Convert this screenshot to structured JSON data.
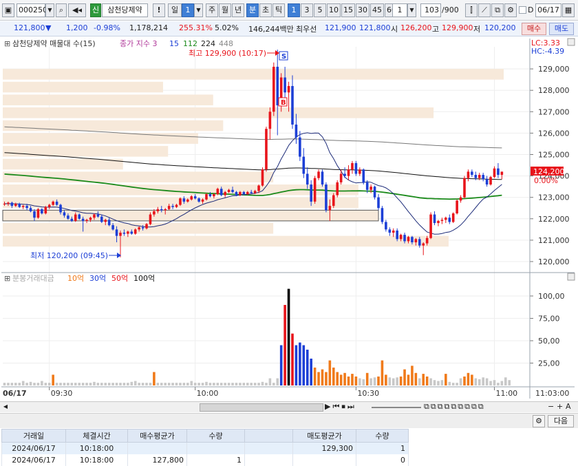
{
  "toolbar": {
    "code": "000250",
    "stock_badge": "신",
    "stock_name": "삼천당제약",
    "alert": "!",
    "period_day": "일",
    "period_count": "1",
    "period_week": "주",
    "period_month": "월",
    "period_year": "년",
    "period_minute": "분",
    "period_second": "초",
    "period_tick": "틱",
    "intervals": [
      "1",
      "3",
      "5",
      "10",
      "15",
      "30",
      "45",
      "60"
    ],
    "interval_input": "1",
    "page": "103",
    "page_total": "/900",
    "date_check_label": "D",
    "date": "06/17"
  },
  "quote": {
    "price": "121,800",
    "change_arrow": "▼",
    "change": "1,200",
    "change_rate": "-0.98%",
    "volume": "1,178,214",
    "volume_ratio": "255.31%",
    "turnover": "5.02%",
    "amount": "146,244백만",
    "best_label": "최우선",
    "best_ask": "121,900",
    "best_bid": "121,800",
    "open_label": "시",
    "open": "126,200",
    "high_label": "고",
    "high": "129,900",
    "low_label": "저",
    "low": "120,200",
    "buy_btn": "매수",
    "sell_btn": "매도"
  },
  "colors": {
    "up": "#e8141b",
    "down": "#1c3fd6",
    "ma_green": "#1a8a1a",
    "navy": "#1b2a78",
    "gray": "#777777",
    "profile": "#f7e9da"
  },
  "chart_data": {
    "type": "candlestick",
    "price_panel": {
      "legend": {
        "title": "삼천당제약 매물대 수(15)",
        "ma_label": "종가 지수 3",
        "ma_periods": [
          "15",
          "112",
          "224",
          "448"
        ]
      },
      "lc": "LC:3.33",
      "hc": "HC:-4.39",
      "current_price": "124,200",
      "current_rate": "0.00%",
      "y_ticks": [
        "129,000",
        "128,000",
        "127,000",
        "126,000",
        "125,000",
        "124,000",
        "123,000",
        "122,000",
        "121,000",
        "120,000"
      ],
      "ylim": [
        119700,
        130200
      ],
      "high_annotation": "최고 129,900 (10:17)",
      "low_annotation": "최저 120,200 (09:45)",
      "signal_sell": "S",
      "signal_buy": "B",
      "volume_profile": [
        {
          "price_lo": 128500,
          "price_hi": 129000,
          "relative": 1.0
        },
        {
          "price_lo": 127900,
          "price_hi": 128400,
          "relative": 0.32
        },
        {
          "price_lo": 127300,
          "price_hi": 127800,
          "relative": 0.42
        },
        {
          "price_lo": 126700,
          "price_hi": 127200,
          "relative": 0.86
        },
        {
          "price_lo": 126100,
          "price_hi": 126600,
          "relative": 0.44
        },
        {
          "price_lo": 125500,
          "price_hi": 126000,
          "relative": 0.39
        },
        {
          "price_lo": 124900,
          "price_hi": 125400,
          "relative": 0.33
        },
        {
          "price_lo": 124300,
          "price_hi": 124800,
          "relative": 0.24
        },
        {
          "price_lo": 123700,
          "price_hi": 124200,
          "relative": 0.54
        },
        {
          "price_lo": 123100,
          "price_hi": 123600,
          "relative": 0.71
        },
        {
          "price_lo": 122500,
          "price_hi": 123000,
          "relative": 0.71
        },
        {
          "price_lo": 121900,
          "price_hi": 122400,
          "relative": 0.75
        },
        {
          "price_lo": 121300,
          "price_hi": 121800,
          "relative": 0.54
        },
        {
          "price_lo": 120700,
          "price_hi": 121200,
          "relative": 0.89
        }
      ]
    },
    "volume_panel": {
      "legend": {
        "title": "분봉거래대금",
        "items": [
          "10억",
          "30억",
          "50억",
          "100억"
        ]
      },
      "y_ticks": [
        "100,00",
        "75,00",
        "50,00",
        "25,00"
      ],
      "ylim": [
        0,
        110
      ]
    },
    "x_ticks": [
      "06/17",
      "09:30",
      "10:00",
      "10:30",
      "11:00",
      "11:03:00"
    ],
    "candles": [
      [
        122700,
        122800,
        122600,
        122700
      ],
      [
        122700,
        122800,
        122600,
        122750
      ],
      [
        122750,
        122800,
        122500,
        122600
      ],
      [
        122600,
        122750,
        122550,
        122700
      ],
      [
        122700,
        122750,
        122500,
        122550
      ],
      [
        122550,
        122650,
        122450,
        122600
      ],
      [
        122600,
        122700,
        122400,
        122500
      ],
      [
        122500,
        122600,
        122300,
        122350
      ],
      [
        122350,
        122450,
        121900,
        122050
      ],
      [
        122050,
        122500,
        122000,
        122450
      ],
      [
        122450,
        122500,
        122200,
        122250
      ],
      [
        122250,
        122600,
        122200,
        122550
      ],
      [
        122550,
        122700,
        122450,
        122650
      ],
      [
        122650,
        122850,
        122600,
        122800
      ],
      [
        122800,
        122900,
        122600,
        122650
      ],
      [
        122650,
        122700,
        122200,
        122300
      ],
      [
        122300,
        122400,
        122050,
        122150
      ],
      [
        122150,
        122250,
        121950,
        122000
      ],
      [
        122000,
        122100,
        121850,
        121900
      ],
      [
        121900,
        122300,
        121850,
        122200
      ],
      [
        122200,
        122250,
        121950,
        122000
      ],
      [
        122000,
        122100,
        121400,
        121900
      ],
      [
        121900,
        122000,
        121800,
        121950
      ],
      [
        121950,
        122100,
        121850,
        122050
      ],
      [
        122050,
        122250,
        121950,
        122200
      ],
      [
        122200,
        122350,
        122050,
        122100
      ],
      [
        122100,
        122200,
        121800,
        121850
      ],
      [
        121850,
        122000,
        121700,
        121950
      ],
      [
        121950,
        122050,
        121650,
        121700
      ],
      [
        121700,
        121800,
        121450,
        121500
      ],
      [
        121500,
        121650,
        120900,
        121200
      ],
      [
        121200,
        121450,
        120200,
        121350
      ],
      [
        121350,
        121500,
        121200,
        121300
      ],
      [
        121300,
        121450,
        121150,
        121400
      ],
      [
        121400,
        121500,
        121250,
        121300
      ],
      [
        121300,
        121550,
        121250,
        121500
      ],
      [
        121500,
        121650,
        121400,
        121600
      ],
      [
        121600,
        121700,
        121450,
        121550
      ],
      [
        121550,
        121800,
        121500,
        121750
      ],
      [
        121750,
        122300,
        121700,
        122200
      ],
      [
        122200,
        122450,
        122100,
        122350
      ],
      [
        122350,
        122550,
        122250,
        122450
      ],
      [
        122450,
        122600,
        122300,
        122400
      ],
      [
        122400,
        122500,
        122200,
        122450
      ],
      [
        122450,
        122700,
        122400,
        122600
      ],
      [
        122600,
        122700,
        122450,
        122550
      ],
      [
        122550,
        122700,
        122500,
        122650
      ],
      [
        122650,
        123000,
        122600,
        122950
      ],
      [
        122950,
        123050,
        122700,
        122800
      ],
      [
        122800,
        122950,
        122750,
        122900
      ],
      [
        122900,
        123100,
        122850,
        123050
      ],
      [
        123050,
        123150,
        122900,
        122950
      ],
      [
        122950,
        123000,
        122750,
        122800
      ],
      [
        122800,
        122950,
        122700,
        122900
      ],
      [
        122900,
        123200,
        122850,
        123150
      ],
      [
        123150,
        123250,
        123000,
        123050
      ],
      [
        123050,
        123200,
        122950,
        123150
      ],
      [
        123150,
        123450,
        123100,
        123400
      ],
      [
        123400,
        123500,
        123050,
        123100
      ],
      [
        123100,
        123300,
        123000,
        123250
      ],
      [
        123250,
        123400,
        123200,
        123350
      ],
      [
        123350,
        123500,
        123200,
        123250
      ],
      [
        123250,
        123300,
        123050,
        123100
      ],
      [
        123100,
        123300,
        123050,
        123250
      ],
      [
        123250,
        123300,
        123100,
        123150
      ],
      [
        123150,
        123300,
        123100,
        123250
      ],
      [
        123250,
        123350,
        123150,
        123200
      ],
      [
        123200,
        123350,
        123150,
        123300
      ],
      [
        123300,
        123600,
        123200,
        123550
      ],
      [
        123550,
        124400,
        123500,
        124300
      ],
      [
        124300,
        126300,
        124200,
        126200
      ],
      [
        126200,
        127200,
        125700,
        127000
      ],
      [
        127000,
        129300,
        126800,
        129100
      ],
      [
        129100,
        129900,
        125900,
        127300
      ],
      [
        127300,
        128800,
        127000,
        128600
      ],
      [
        128600,
        129100,
        127600,
        127900
      ],
      [
        127900,
        128400,
        127000,
        128200
      ],
      [
        128200,
        128700,
        126200,
        126400
      ],
      [
        126400,
        126900,
        125500,
        125800
      ],
      [
        125800,
        126100,
        124700,
        124900
      ],
      [
        124900,
        125300,
        123900,
        124100
      ],
      [
        124100,
        124400,
        123400,
        123600
      ],
      [
        123600,
        123800,
        122600,
        122800
      ],
      [
        122800,
        124000,
        122700,
        123900
      ],
      [
        123900,
        124300,
        123800,
        124200
      ],
      [
        124200,
        124300,
        123500,
        123600
      ],
      [
        123600,
        123700,
        122300,
        122400
      ],
      [
        122400,
        122900,
        121900,
        122600
      ],
      [
        122600,
        123200,
        122500,
        123100
      ],
      [
        123100,
        123800,
        123000,
        123700
      ],
      [
        123700,
        124300,
        123600,
        124100
      ],
      [
        124100,
        124400,
        123900,
        124000
      ],
      [
        124000,
        124500,
        123800,
        124300
      ],
      [
        124300,
        124700,
        124100,
        124600
      ],
      [
        124600,
        124700,
        124000,
        124100
      ],
      [
        124100,
        124400,
        124000,
        124300
      ],
      [
        124300,
        124350,
        123600,
        123700
      ],
      [
        123700,
        123800,
        123200,
        123350
      ],
      [
        123350,
        123600,
        123200,
        123500
      ],
      [
        123500,
        123550,
        122900,
        123000
      ],
      [
        123000,
        123150,
        122400,
        122500
      ],
      [
        122500,
        122600,
        121750,
        121850
      ],
      [
        121850,
        121950,
        121400,
        121500
      ],
      [
        121500,
        121600,
        121200,
        121350
      ],
      [
        121350,
        121550,
        121150,
        121450
      ],
      [
        121450,
        121550,
        120950,
        121050
      ],
      [
        121050,
        121300,
        120950,
        121250
      ],
      [
        121250,
        121350,
        120850,
        120950
      ],
      [
        120950,
        121200,
        120850,
        121150
      ],
      [
        121150,
        121200,
        120800,
        120900
      ],
      [
        120900,
        121100,
        120750,
        121050
      ],
      [
        121050,
        121150,
        120650,
        120750
      ],
      [
        120750,
        120900,
        120300,
        120850
      ],
      [
        120850,
        121200,
        120750,
        121100
      ],
      [
        121100,
        122300,
        121050,
        122200
      ],
      [
        122200,
        122350,
        121700,
        121800
      ],
      [
        121800,
        121950,
        121650,
        121900
      ],
      [
        121900,
        122050,
        121750,
        121950
      ],
      [
        121950,
        122100,
        121800,
        122050
      ],
      [
        122050,
        122200,
        121750,
        121850
      ],
      [
        121850,
        122300,
        121800,
        122250
      ],
      [
        122250,
        122900,
        122200,
        122850
      ],
      [
        122850,
        123100,
        122750,
        123000
      ],
      [
        123000,
        124000,
        122950,
        123900
      ],
      [
        123900,
        124300,
        123750,
        124200
      ],
      [
        124200,
        124300,
        123950,
        124050
      ],
      [
        124050,
        124200,
        123800,
        123900
      ],
      [
        123900,
        124150,
        123800,
        124050
      ],
      [
        124050,
        124150,
        123750,
        123850
      ],
      [
        123850,
        124000,
        123500,
        123600
      ],
      [
        123600,
        124000,
        123550,
        123950
      ],
      [
        123950,
        124450,
        123900,
        124350
      ],
      [
        124350,
        124600,
        123900,
        124050
      ],
      [
        124050,
        124200,
        123850,
        124200
      ]
    ],
    "trade_volume": [
      3,
      3,
      3,
      3,
      3,
      5,
      3,
      4,
      3,
      3,
      5,
      3,
      3,
      12,
      3,
      3,
      3,
      3,
      3,
      3,
      3,
      3,
      3,
      3,
      4,
      3,
      3,
      3,
      3,
      3,
      3,
      3,
      3,
      3,
      4,
      5,
      3,
      3,
      3,
      3,
      15,
      3,
      3,
      3,
      3,
      3,
      3,
      3,
      3,
      3,
      5,
      3,
      3,
      3,
      4,
      3,
      3,
      3,
      3,
      3,
      3,
      3,
      3,
      3,
      3,
      3,
      3,
      3,
      3,
      4,
      3,
      8,
      3,
      8,
      45,
      90,
      108,
      58,
      45,
      48,
      45,
      40,
      30,
      20,
      15,
      18,
      15,
      28,
      20,
      15,
      12,
      14,
      10,
      13,
      10,
      8,
      7,
      14,
      8,
      9,
      10,
      28,
      12,
      9,
      8,
      9,
      10,
      18,
      12,
      22,
      14,
      8,
      13,
      10,
      8,
      6,
      5,
      6,
      13,
      4,
      3,
      3,
      8,
      10,
      14,
      12,
      8,
      7,
      9,
      8,
      5,
      6,
      3,
      5,
      9,
      6
    ]
  },
  "trades": {
    "headers": [
      "거래일",
      "체결시간",
      "매수평균가",
      "수량",
      "",
      "매도평균가",
      "수량"
    ],
    "rows": [
      [
        "2024/06/17",
        "10:18:00",
        "",
        "",
        "",
        "129,300",
        "1"
      ],
      [
        "2024/06/17",
        "10:18:00",
        "127,800",
        "1",
        "",
        "",
        "0"
      ]
    ]
  },
  "bottom": {
    "settings_icon": "gear-icon",
    "next_btn": "다음"
  }
}
